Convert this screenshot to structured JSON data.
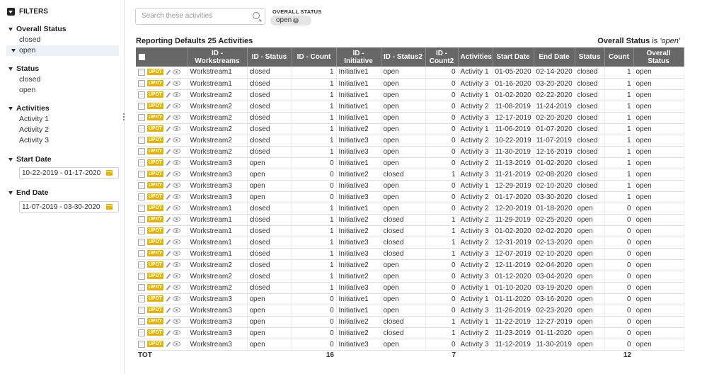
{
  "sidebar": {
    "title": "FILTERS",
    "overall_status": {
      "title": "Overall Status",
      "options": [
        "closed",
        "open"
      ],
      "selected": "open"
    },
    "status": {
      "title": "Status",
      "options": [
        "closed",
        "open"
      ]
    },
    "activities": {
      "title": "Activities",
      "options": [
        "Activity 1",
        "Activity 2",
        "Activity 3"
      ]
    },
    "start_date": {
      "title": "Start Date",
      "value": "10-22-2019 - 01-17-2020"
    },
    "end_date": {
      "title": "End Date",
      "value": "11-07-2019 - 03-30-2020"
    }
  },
  "search": {
    "placeholder": "Search these activities"
  },
  "overall_filter": {
    "label": "OVERALL STATUS",
    "chip": "open"
  },
  "report": {
    "title": "Reporting Defaults 25 Activities",
    "note_field": "Overall Status",
    "note_is": "is",
    "note_value": "'open'"
  },
  "table": {
    "row_badge": "UPDT",
    "headers": [
      "ID - Workstreams",
      "ID - Status",
      "ID - Count",
      "ID - Initiative",
      "ID - Status2",
      "ID - Count2",
      "Activities",
      "Start Date",
      "End Date",
      "Status",
      "Count",
      "Overall Status"
    ],
    "rows": [
      [
        "Workstream1",
        "closed",
        "1",
        "Initiative1",
        "open",
        "0",
        "Activity 1",
        "01-05-2020",
        "02-14-2020",
        "closed",
        "1",
        "open"
      ],
      [
        "Workstream1",
        "closed",
        "1",
        "Initiative1",
        "open",
        "0",
        "Activity 3",
        "01-16-2020",
        "03-20-2020",
        "closed",
        "1",
        "open"
      ],
      [
        "Workstream2",
        "closed",
        "1",
        "Initiative1",
        "open",
        "0",
        "Activity 1",
        "01-02-2020",
        "02-22-2020",
        "closed",
        "1",
        "open"
      ],
      [
        "Workstream2",
        "closed",
        "1",
        "Initiative1",
        "open",
        "0",
        "Activity 2",
        "11-08-2019",
        "11-24-2019",
        "closed",
        "1",
        "open"
      ],
      [
        "Workstream2",
        "closed",
        "1",
        "Initiative1",
        "open",
        "0",
        "Activity 3",
        "12-17-2019",
        "02-20-2020",
        "closed",
        "1",
        "open"
      ],
      [
        "Workstream2",
        "closed",
        "1",
        "Initiative2",
        "open",
        "0",
        "Activity 1",
        "11-06-2019",
        "01-07-2020",
        "closed",
        "1",
        "open"
      ],
      [
        "Workstream2",
        "closed",
        "1",
        "Initiative3",
        "open",
        "0",
        "Activity 2",
        "10-22-2019",
        "11-07-2019",
        "closed",
        "1",
        "open"
      ],
      [
        "Workstream2",
        "closed",
        "1",
        "Initiative3",
        "open",
        "0",
        "Activity 3",
        "11-30-2019",
        "12-16-2019",
        "closed",
        "1",
        "open"
      ],
      [
        "Workstream3",
        "open",
        "0",
        "Initiative1",
        "open",
        "0",
        "Activity 2",
        "11-13-2019",
        "01-02-2020",
        "closed",
        "1",
        "open"
      ],
      [
        "Workstream3",
        "open",
        "0",
        "Initiative2",
        "closed",
        "1",
        "Activity 3",
        "11-21-2019",
        "02-08-2020",
        "closed",
        "1",
        "open"
      ],
      [
        "Workstream3",
        "open",
        "0",
        "Initiative3",
        "open",
        "0",
        "Activity 1",
        "12-29-2019",
        "02-10-2020",
        "closed",
        "1",
        "open"
      ],
      [
        "Workstream3",
        "open",
        "0",
        "Initiative3",
        "open",
        "0",
        "Activity 2",
        "01-17-2020",
        "03-30-2020",
        "closed",
        "1",
        "open"
      ],
      [
        "Workstream1",
        "closed",
        "1",
        "Initiative1",
        "open",
        "0",
        "Activity 2",
        "12-20-2019",
        "01-18-2020",
        "open",
        "0",
        "open"
      ],
      [
        "Workstream1",
        "closed",
        "1",
        "Initiative2",
        "closed",
        "1",
        "Activity 2",
        "11-29-2019",
        "02-25-2020",
        "open",
        "0",
        "open"
      ],
      [
        "Workstream1",
        "closed",
        "1",
        "Initiative2",
        "closed",
        "1",
        "Activity 3",
        "01-02-2020",
        "02-02-2020",
        "open",
        "0",
        "open"
      ],
      [
        "Workstream1",
        "closed",
        "1",
        "Initiative3",
        "closed",
        "1",
        "Activity 2",
        "12-31-2019",
        "02-13-2020",
        "open",
        "0",
        "open"
      ],
      [
        "Workstream1",
        "closed",
        "1",
        "Initiative3",
        "closed",
        "1",
        "Activity 3",
        "12-07-2019",
        "02-10-2020",
        "open",
        "0",
        "open"
      ],
      [
        "Workstream2",
        "closed",
        "1",
        "Initiative2",
        "open",
        "0",
        "Activity 2",
        "12-11-2019",
        "02-04-2020",
        "open",
        "0",
        "open"
      ],
      [
        "Workstream2",
        "closed",
        "1",
        "Initiative2",
        "open",
        "0",
        "Activity 3",
        "01-12-2020",
        "03-04-2020",
        "open",
        "0",
        "open"
      ],
      [
        "Workstream2",
        "closed",
        "1",
        "Initiative3",
        "open",
        "0",
        "Activity 1",
        "01-10-2020",
        "03-19-2020",
        "open",
        "0",
        "open"
      ],
      [
        "Workstream3",
        "open",
        "0",
        "Initiative1",
        "open",
        "0",
        "Activity 1",
        "01-11-2020",
        "03-16-2020",
        "open",
        "0",
        "open"
      ],
      [
        "Workstream3",
        "open",
        "0",
        "Initiative1",
        "open",
        "0",
        "Activity 3",
        "11-26-2019",
        "02-23-2020",
        "open",
        "0",
        "open"
      ],
      [
        "Workstream3",
        "open",
        "0",
        "Initiative2",
        "closed",
        "1",
        "Activity 1",
        "11-22-2019",
        "12-27-2019",
        "open",
        "0",
        "open"
      ],
      [
        "Workstream3",
        "open",
        "0",
        "Initiative2",
        "closed",
        "1",
        "Activity 2",
        "11-23-2019",
        "01-11-2020",
        "open",
        "0",
        "open"
      ],
      [
        "Workstream3",
        "open",
        "0",
        "Initiative3",
        "open",
        "0",
        "Activity 3",
        "11-12-2019",
        "11-30-2019",
        "open",
        "0",
        "open"
      ]
    ],
    "totals": {
      "label": "TOT",
      "id_count": "16",
      "id_count2": "7",
      "count": "12"
    }
  }
}
